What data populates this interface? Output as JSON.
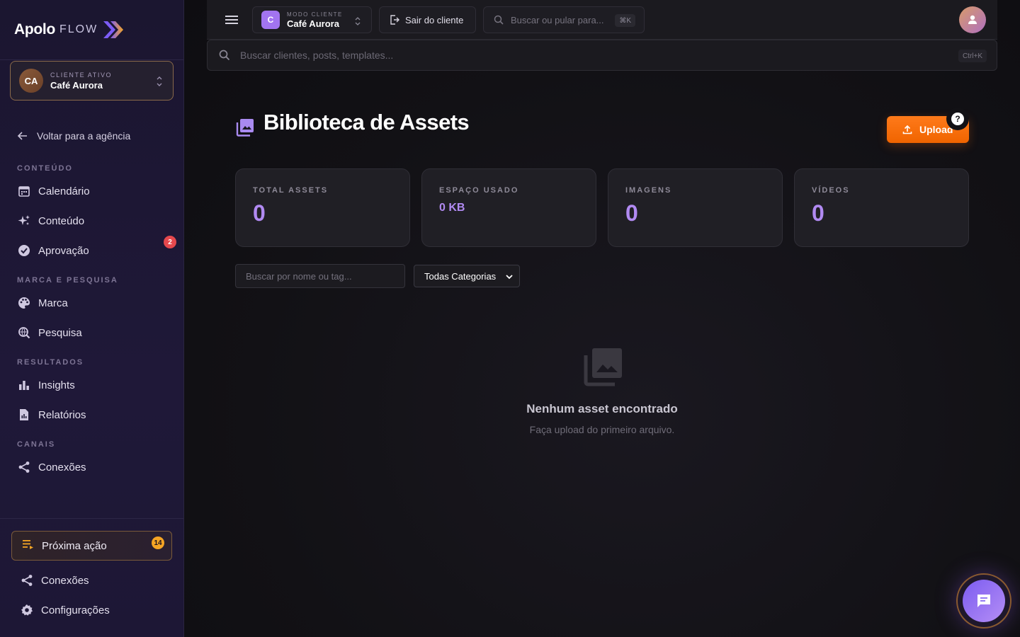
{
  "brand": {
    "name": "Apolo",
    "suffix": "FLOW",
    "accent": "#8b5cf6",
    "accent_orange": "#f97316"
  },
  "sidebar": {
    "client": {
      "initials": "CA",
      "label": "CLIENTE ATIVO",
      "name": "Café Aurora"
    },
    "back_link": "Voltar para a agência",
    "sections": [
      {
        "title": "CONTEÚDO",
        "items": [
          {
            "label": "Calendário",
            "icon": "calendar-icon"
          },
          {
            "label": "Conteúdo",
            "icon": "sparkles-icon"
          },
          {
            "label": "Aprovação",
            "icon": "check-circle-icon",
            "badge": "2"
          }
        ]
      },
      {
        "title": "MARCA E PESQUISA",
        "items": [
          {
            "label": "Marca",
            "icon": "palette-icon"
          },
          {
            "label": "Pesquisa",
            "icon": "search-globe-icon"
          }
        ]
      },
      {
        "title": "RESULTADOS",
        "items": [
          {
            "label": "Insights",
            "icon": "bar-chart-icon"
          },
          {
            "label": "Relatórios",
            "icon": "report-icon"
          }
        ]
      },
      {
        "title": "CANAIS",
        "items": [
          {
            "label": "Conexões",
            "icon": "share-icon"
          }
        ]
      }
    ],
    "bottom": {
      "next_action": {
        "label": "Próxima ação",
        "badge": "14",
        "icon": "playlist-icon"
      },
      "connections": "Conexões",
      "settings": "Configurações"
    }
  },
  "topbar": {
    "mode": {
      "initial": "C",
      "label": "MODO CLIENTE",
      "name": "Café Aurora"
    },
    "exit_label": "Sair do cliente",
    "quick_search_placeholder": "Buscar ou pular para...",
    "quick_search_kbd": "⌘K"
  },
  "global_search": {
    "placeholder": "Buscar clientes, posts, templates...",
    "kbd": "Ctrl+K"
  },
  "page": {
    "title": "Biblioteca de Assets",
    "upload_label": "Upload",
    "help": "?",
    "stats": [
      {
        "label": "TOTAL ASSETS",
        "value": "0"
      },
      {
        "label": "ESPAÇO USADO",
        "value": "0 KB"
      },
      {
        "label": "IMAGENS",
        "value": "0"
      },
      {
        "label": "VÍDEOS",
        "value": "0"
      }
    ],
    "filters": {
      "search_placeholder": "Buscar por nome ou tag...",
      "category_selected": "Todas Categorias"
    },
    "empty": {
      "title": "Nenhum asset encontrado",
      "subtitle": "Faça upload do primeiro arquivo."
    }
  }
}
